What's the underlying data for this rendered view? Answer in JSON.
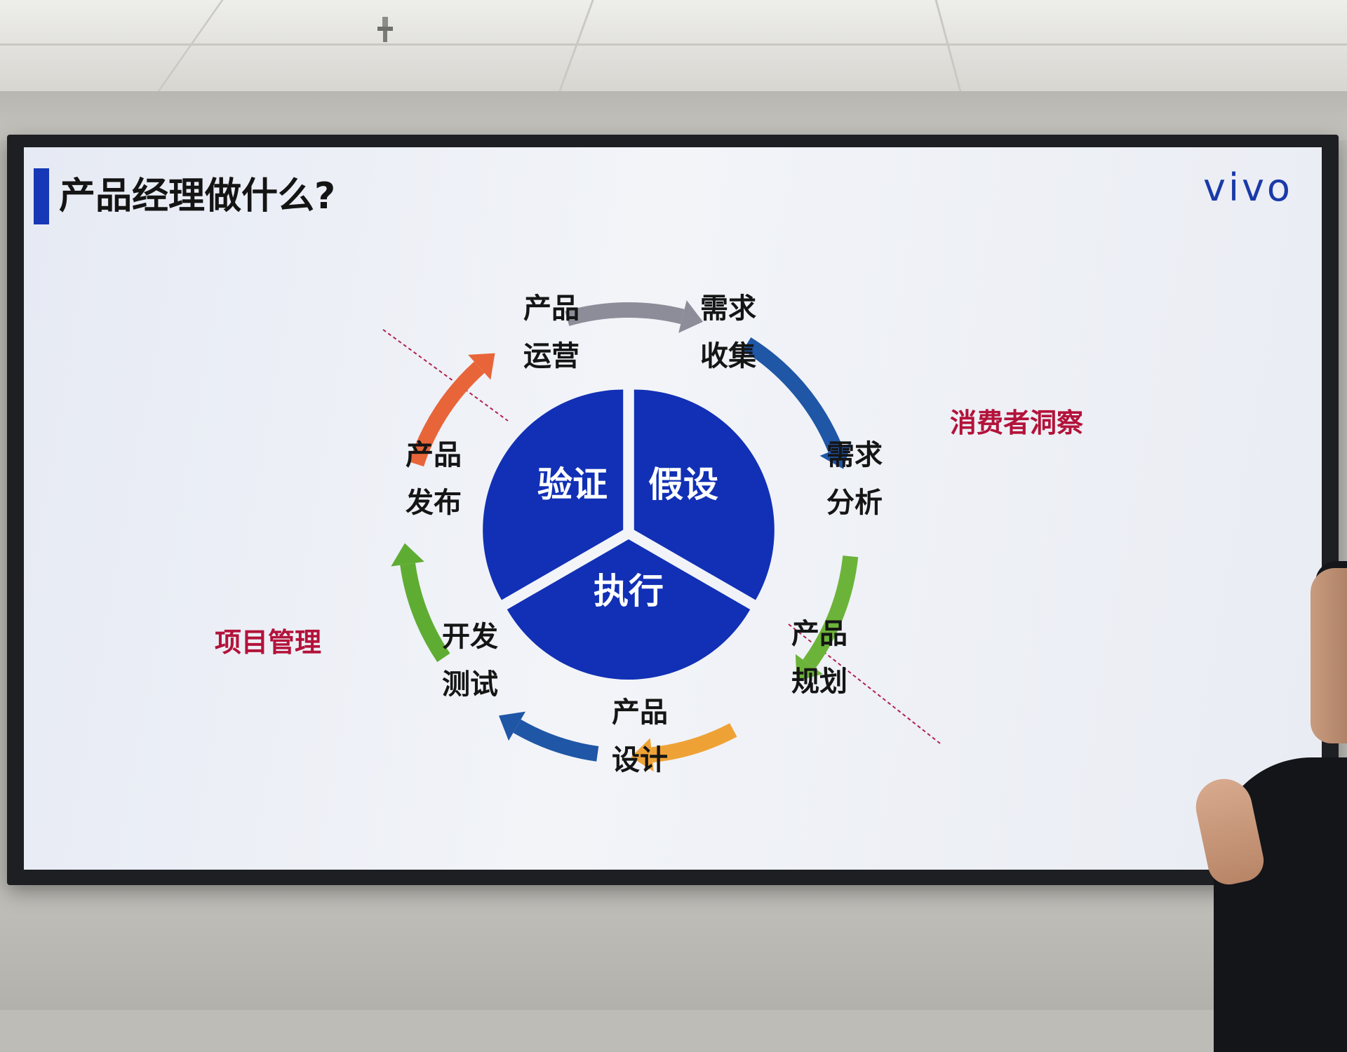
{
  "slide": {
    "title": "产品经理做什么?",
    "logo": "vivo",
    "colors": {
      "title_bar": "#1637b6",
      "logo": "#1a3aa8",
      "pie": "#1130b5",
      "side_label": "#b3123a"
    }
  },
  "center": {
    "segments": [
      "验证",
      "假设",
      "执行"
    ]
  },
  "cycle": {
    "nodes": [
      {
        "line1": "产品",
        "line2": "运营"
      },
      {
        "line1": "需求",
        "line2": "收集"
      },
      {
        "line1": "需求",
        "line2": "分析"
      },
      {
        "line1": "产品",
        "line2": "规划"
      },
      {
        "line1": "产品",
        "line2": "设计"
      },
      {
        "line1": "开发",
        "line2": "测试"
      },
      {
        "line1": "产品",
        "line2": "发布"
      }
    ],
    "arrow_colors": [
      "#8d8d99",
      "#1f56a6",
      "#6cb33a",
      "#eea236",
      "#1f56a6",
      "#5fac33",
      "#e8653a"
    ]
  },
  "labels": {
    "consumer_insight": "消费者洞察",
    "project_management": "项目管理"
  }
}
